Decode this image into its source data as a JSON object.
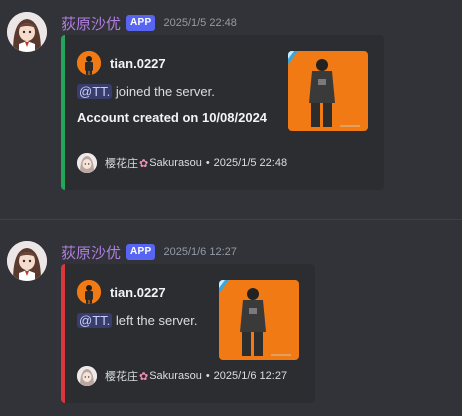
{
  "messages": [
    {
      "username": "荻原沙优",
      "badge": "APP",
      "timestamp": "2025/1/5 22:48",
      "embed": {
        "accent_color": "#23a55a",
        "author": "tian.0227",
        "mention": "@TT.",
        "description": " joined the server.",
        "bold_line": "Account created on 10/08/2024",
        "footer": {
          "name_cjk": "樱花庄",
          "flower_icon": "sakura-icon",
          "name_latin": "Sakurasou",
          "separator": "•",
          "time": "2025/1/5 22:48"
        }
      }
    },
    {
      "username": "荻原沙优",
      "badge": "APP",
      "timestamp": "2025/1/6 12:27",
      "embed": {
        "accent_color": "#da373c",
        "author": "tian.0227",
        "mention": "@TT.",
        "description": " left the server.",
        "footer": {
          "name_cjk": "樱花庄",
          "flower_icon": "sakura-icon",
          "name_latin": "Sakurasou",
          "separator": "•",
          "time": "2025/1/6 12:27"
        }
      }
    }
  ]
}
